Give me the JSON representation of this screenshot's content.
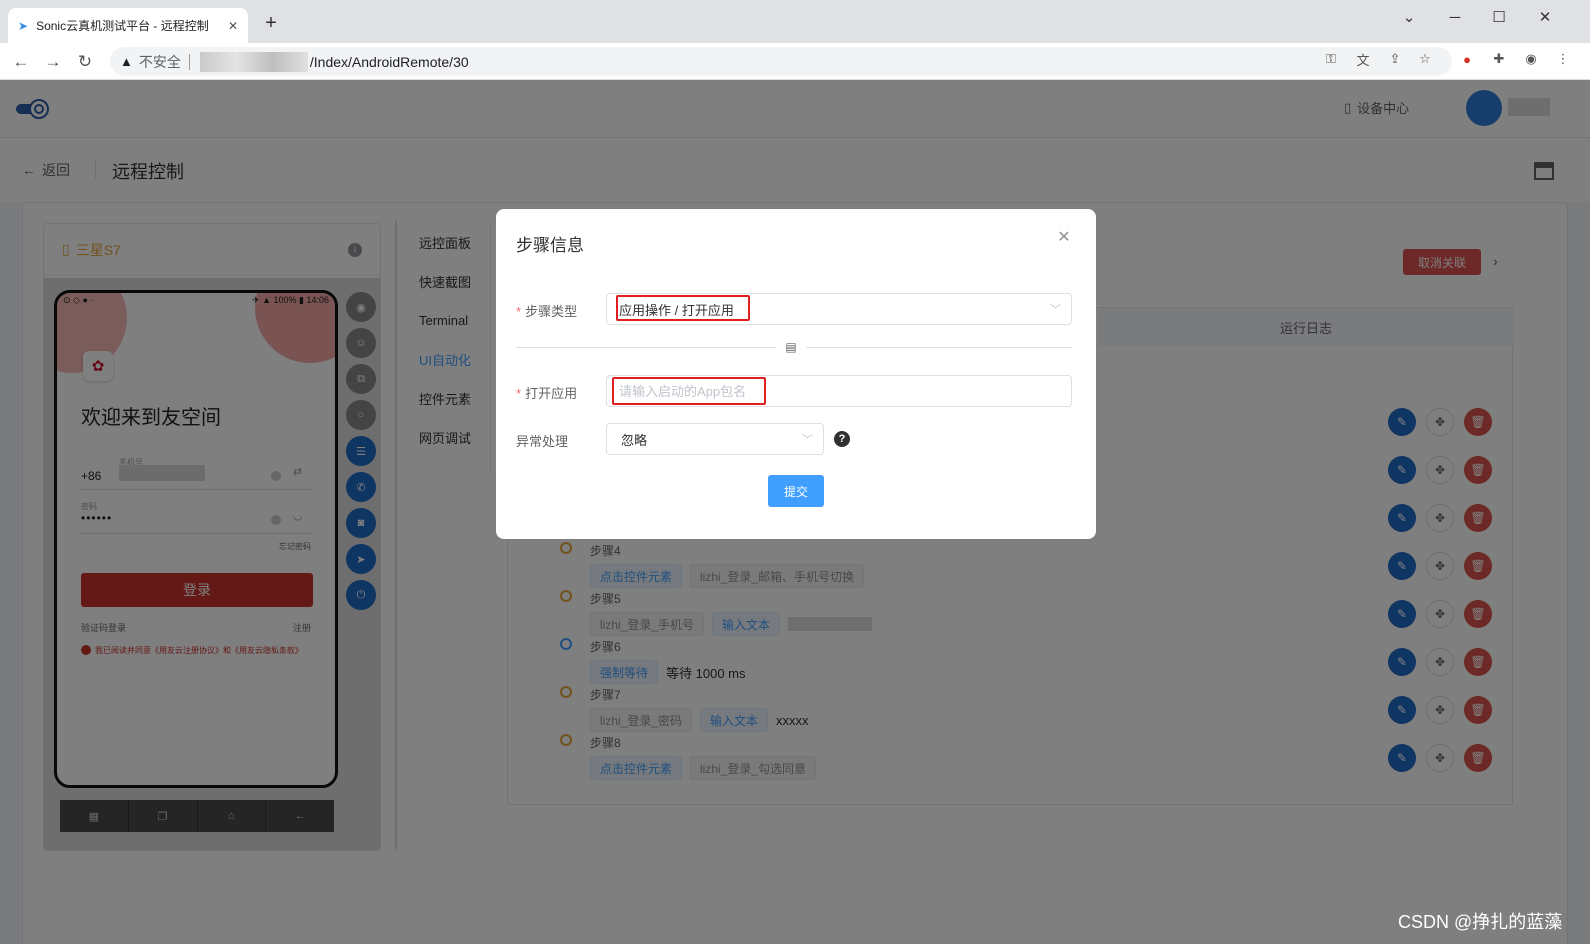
{
  "browser": {
    "tab_title": "Sonic云真机测试平台 - 远程控制",
    "security_label": "不安全",
    "url_path": "/Index/AndroidRemote/30"
  },
  "app": {
    "device_center_label": "设备中心",
    "back_label": "返回",
    "page_title": "远程控制"
  },
  "phone": {
    "device_name": "三星S7",
    "status_left": "⊙ ◇ ● ·",
    "status_right": "✈ ▲ 100% ▮ 14:06",
    "welcome_text": "欢迎来到友空间",
    "country_code": "+86",
    "phone_label": "手机号",
    "password_label": "密码",
    "password_mask": "••••••",
    "forgot_password": "忘记密码",
    "login_button": "登录",
    "sms_login": "验证码登录",
    "register": "注册",
    "agreement": "我已阅读并同意《用友云注册协议》和《用友云隐私条款》"
  },
  "side_tabs": [
    "远控面板",
    "快速截图",
    "Terminal",
    "UI自动化",
    "控件元素",
    "网页调试"
  ],
  "active_side_tab": "UI自动化",
  "steps_panel": {
    "unlink_button": "取消关联",
    "log_header": "运行日志",
    "steps": [
      {
        "label": "步骤4",
        "dot": "orange",
        "items": [
          {
            "type": "tag-blue",
            "text": "点击控件元素"
          },
          {
            "type": "tag-gray",
            "text": "lizhi_登录_邮箱、手机号切换"
          }
        ]
      },
      {
        "label": "步骤5",
        "dot": "orange",
        "items": [
          {
            "type": "tag-gray",
            "text": "lizhi_登录_手机号"
          },
          {
            "type": "tag-blue",
            "text": "输入文本"
          }
        ]
      },
      {
        "label": "步骤6",
        "dot": "blue",
        "items": [
          {
            "type": "tag-blue",
            "text": "强制等待"
          },
          {
            "type": "text",
            "text": "等待 1000 ms"
          }
        ]
      },
      {
        "label": "步骤7",
        "dot": "orange",
        "items": [
          {
            "type": "tag-gray",
            "text": "lizhi_登录_密码"
          },
          {
            "type": "tag-blue",
            "text": "输入文本"
          },
          {
            "type": "text",
            "text": "xxxxx"
          }
        ]
      },
      {
        "label": "步骤8",
        "dot": "orange",
        "items": [
          {
            "type": "tag-blue",
            "text": "点击控件元素"
          },
          {
            "type": "tag-gray",
            "text": "lizhi_登录_勾选同意"
          }
        ]
      }
    ]
  },
  "dialog": {
    "title": "步骤信息",
    "step_type_label": "步骤类型",
    "step_type_value": "应用操作 / 打开应用",
    "open_app_label": "打开应用",
    "open_app_placeholder": "请输入启动的App包名",
    "open_app_value": "",
    "error_handling_label": "异常处理",
    "error_handling_value": "忽略",
    "submit_label": "提交"
  },
  "watermark": "CSDN @挣扎的蓝藻",
  "colors": {
    "accent": "#409eff",
    "danger": "#d9534f",
    "brand_red": "#c8332f",
    "highlight_box": "#e02020"
  }
}
